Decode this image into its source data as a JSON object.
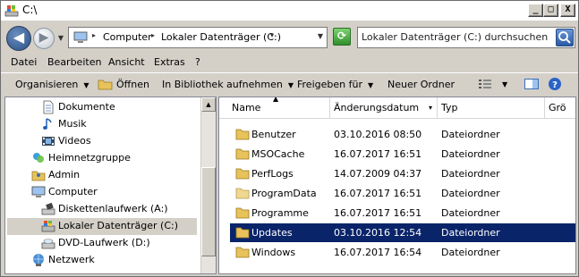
{
  "window": {
    "title": "C:\\"
  },
  "title_buttons": {
    "minimize": "_",
    "maximize": "□",
    "close": "X"
  },
  "address": {
    "crumbs": [
      "Computer",
      "Lokaler Datenträger (C:)"
    ],
    "search_placeholder": "Lokaler Datenträger (C:) durchsuchen"
  },
  "menubar": {
    "items": [
      {
        "label": "Datei"
      },
      {
        "label": "Bearbeiten"
      },
      {
        "label": "Ansicht"
      },
      {
        "label": "Extras"
      },
      {
        "label": "?"
      }
    ]
  },
  "toolbar": {
    "organize": "Organisieren",
    "open": "Öffnen",
    "library": "In Bibliothek aufnehmen",
    "share": "Freigeben für",
    "new_folder": "Neuer Ordner"
  },
  "navpane": {
    "items": [
      {
        "label": "Dokumente",
        "icon": "document-icon"
      },
      {
        "label": "Musik",
        "icon": "music-icon"
      },
      {
        "label": "Videos",
        "icon": "video-icon"
      },
      {
        "label": "Heimnetzgruppe",
        "icon": "homegroup-icon"
      },
      {
        "label": "Admin",
        "icon": "user-folder-icon"
      },
      {
        "label": "Computer",
        "icon": "computer-icon"
      },
      {
        "label": "Diskettenlaufwerk (A:)",
        "icon": "floppy-drive-icon"
      },
      {
        "label": "Lokaler Datenträger (C:)",
        "icon": "hard-drive-icon",
        "selected": true
      },
      {
        "label": "DVD-Laufwerk (D:)",
        "icon": "dvd-drive-icon"
      },
      {
        "label": "Netzwerk",
        "icon": "network-icon"
      }
    ]
  },
  "filelist": {
    "columns": [
      "Name",
      "Änderungsdatum",
      "Typ",
      "Grö"
    ],
    "rows": [
      {
        "name": "Benutzer",
        "date": "03.10.2016 08:50",
        "type": "Dateiordner"
      },
      {
        "name": "MSOCache",
        "date": "16.07.2017 16:51",
        "type": "Dateiordner"
      },
      {
        "name": "PerfLogs",
        "date": "14.07.2009 04:37",
        "type": "Dateiordner"
      },
      {
        "name": "ProgramData",
        "date": "16.07.2017 16:51",
        "type": "Dateiordner"
      },
      {
        "name": "Programme",
        "date": "16.07.2017 16:51",
        "type": "Dateiordner"
      },
      {
        "name": "Updates",
        "date": "03.10.2016 12:54",
        "type": "Dateiordner",
        "selected": true
      },
      {
        "name": "Windows",
        "date": "16.07.2017 16:54",
        "type": "Dateiordner"
      }
    ]
  },
  "colors": {
    "selection": "#0a246a",
    "window_face": "#d4d0c8",
    "folder": "#e8c25a"
  }
}
